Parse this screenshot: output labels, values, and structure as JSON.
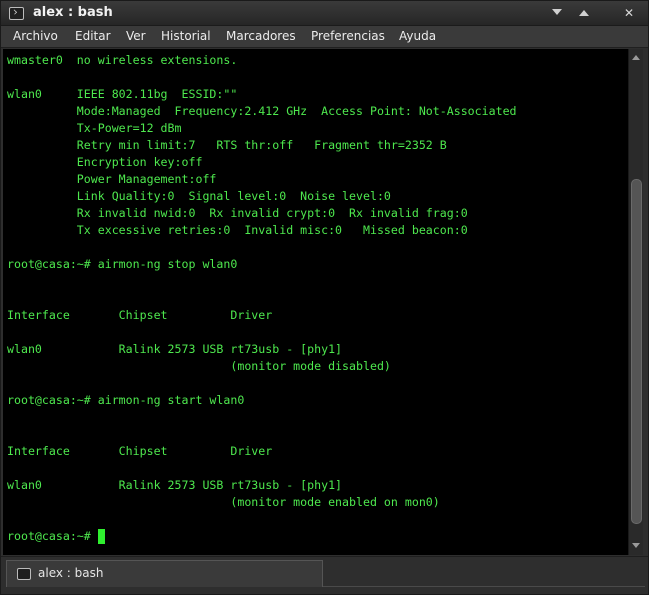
{
  "window": {
    "title": "alex : bash"
  },
  "menubar": {
    "items": [
      "Archivo",
      "Editar",
      "Ver",
      "Historial",
      "Marcadores",
      "Preferencias",
      "Ayuda"
    ]
  },
  "terminal": {
    "lines": [
      "wmaster0  no wireless extensions.",
      "",
      "wlan0     IEEE 802.11bg  ESSID:\"\"",
      "          Mode:Managed  Frequency:2.412 GHz  Access Point: Not-Associated",
      "          Tx-Power=12 dBm",
      "          Retry min limit:7   RTS thr:off   Fragment thr=2352 B",
      "          Encryption key:off",
      "          Power Management:off",
      "          Link Quality:0  Signal level:0  Noise level:0",
      "          Rx invalid nwid:0  Rx invalid crypt:0  Rx invalid frag:0",
      "          Tx excessive retries:0  Invalid misc:0   Missed beacon:0",
      "",
      "root@casa:~# airmon-ng stop wlan0",
      "",
      "",
      "Interface       Chipset         Driver",
      "",
      "wlan0           Ralink 2573 USB rt73usb - [phy1]",
      "                                (monitor mode disabled)",
      "",
      "root@casa:~# airmon-ng start wlan0",
      "",
      "",
      "Interface       Chipset         Driver",
      "",
      "wlan0           Ralink 2573 USB rt73usb - [phy1]",
      "                                (monitor mode enabled on mon0)",
      "",
      "root@casa:~# "
    ],
    "colors": {
      "text": "#4ee84e",
      "background": "#000000",
      "cursor": "#2fef2f"
    }
  },
  "tabs": [
    {
      "label": "alex : bash"
    }
  ]
}
